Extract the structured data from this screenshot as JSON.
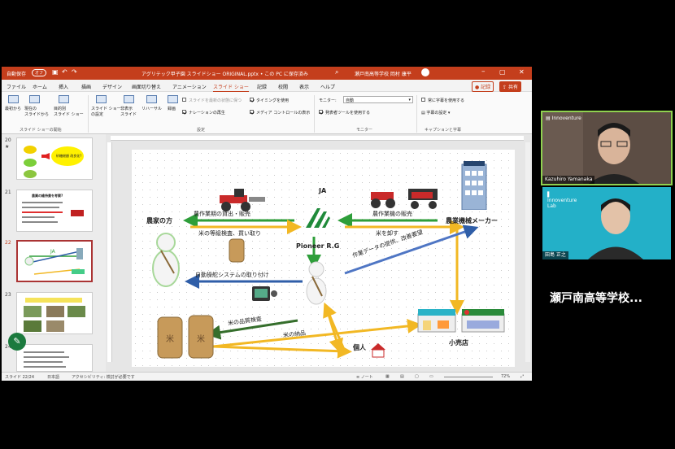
{
  "ppt": {
    "titlebar": {
      "autosave": "自動保存",
      "autosave_state": "オフ",
      "filename": "アグリテック甲子園 スライドショー ORIGINAL.pptx • この PC に保存済み",
      "search_placeholder": "瀬戸南高等学校 岡村 康平"
    },
    "menu": {
      "tabs": [
        "ファイル",
        "ホーム",
        "挿入",
        "描画",
        "デザイン",
        "画面切り替え",
        "アニメーション",
        "スライド ショー",
        "記録",
        "校閲",
        "表示",
        "ヘルプ"
      ],
      "active": "スライド ショー",
      "record": "記録",
      "share": "共有"
    },
    "ribbon": {
      "from_start": "最初から",
      "from_current": "現在の\nスライドから",
      "custom": "目的別\nスライド ショー",
      "setup": "スライド ショー\nの設定",
      "hide": "非表示\nスライド",
      "rehearse": "リハーサル",
      "record": "録画",
      "checks": [
        {
          "label": "スライドを最新の状態に保つ",
          "on": false
        },
        {
          "label": "ナレーションの再生",
          "on": true
        },
        {
          "label": "タイミングを使用",
          "on": true
        },
        {
          "label": "メディア コントロールの表示",
          "on": true
        },
        {
          "label": "発表者ツールを使用する",
          "on": true
        },
        {
          "label": "常に字幕を使用する",
          "on": false
        }
      ],
      "monitor_label": "モニター:",
      "monitor_value": "自動",
      "subtitle_settings": "字幕の設定",
      "groups": [
        "スライド ショーの開始",
        "設定",
        "モニター",
        "キャプションと字幕"
      ]
    },
    "thumbs": [
      {
        "num": "20",
        "star": "★",
        "caption": "砂糖総額 改良化?"
      },
      {
        "num": "21",
        "title": "農業の維持費を考察?"
      },
      {
        "num": "22"
      },
      {
        "num": "23"
      },
      {
        "num": "24"
      }
    ],
    "slide": {
      "farmer": "農家の方",
      "ja": "JA",
      "pioneer": "Pioneer R.G",
      "maker": "農業機械メーカー",
      "individual": "個人",
      "retail": "小売店",
      "a_loan": "農作業期の貸出・販売",
      "a_inspect": "米の等級検査、買い取り",
      "a_sell": "農作業機の販売",
      "a_wholesale": "米を卸す",
      "a_auto": "自動操舵システムの取り付け",
      "a_data": "作業データの提供、改善要望",
      "a_quality": "米の品質検査",
      "a_deliver": "米の納品"
    },
    "status": {
      "slide": "スライド 22/24",
      "lang": "日本語",
      "accessibility": "アクセシビリティ: 検討が必要です",
      "notes": "ノート",
      "zoom": "72%"
    }
  },
  "videos": [
    {
      "name": "Kazuhiro Yamanaka",
      "org": "Innoventure"
    },
    {
      "name": "田島 正之",
      "org": "Innoventure Lab"
    },
    {
      "name": "瀬戸南高等学校..."
    }
  ],
  "colors": {
    "ppt_red": "#c43e1c",
    "green": "#2e9e3a",
    "yellow": "#f2b824",
    "blue": "#2f5ea8",
    "darkgreen": "#356e2c",
    "teal": "#2ab3c7"
  }
}
